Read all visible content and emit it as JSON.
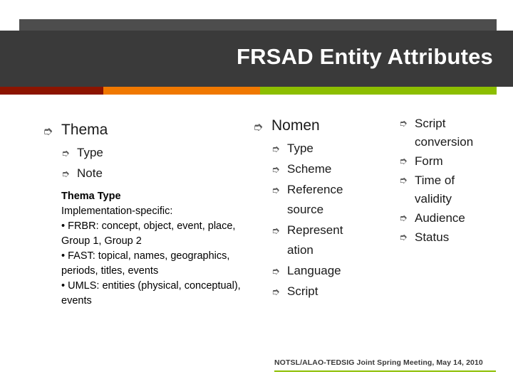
{
  "header": {
    "title": "FRSAD Entity Attributes",
    "accents": {
      "dark_red": "#8c1400",
      "orange": "#f07800",
      "green": "#8cbe00",
      "bar_dark": "#3a3a3a"
    }
  },
  "columns": {
    "left": {
      "heading": "Thema",
      "items": [
        "Type",
        "Note"
      ],
      "note": {
        "title": "Thema Type",
        "lines": [
          "Implementation-specific:",
          "• FRBR: concept, object, event, place, Group 1, Group 2",
          "• FAST: topical, names, geographics, periods, titles, events",
          "• UMLS: entities (physical, conceptual), events"
        ]
      }
    },
    "middle": {
      "heading": "Nomen",
      "items": [
        "Type",
        "Scheme",
        "Reference source",
        "Represent ation",
        "Language",
        "Script"
      ]
    },
    "right": {
      "items": [
        "Script conversion",
        "Form",
        "Time of validity",
        "Audience",
        "Status"
      ]
    }
  },
  "footer": {
    "text": "NOTSL/ALAO-TEDSIG Joint Spring Meeting, May 14, 2010"
  },
  "icons": {
    "bullet_arrow": "➮"
  }
}
